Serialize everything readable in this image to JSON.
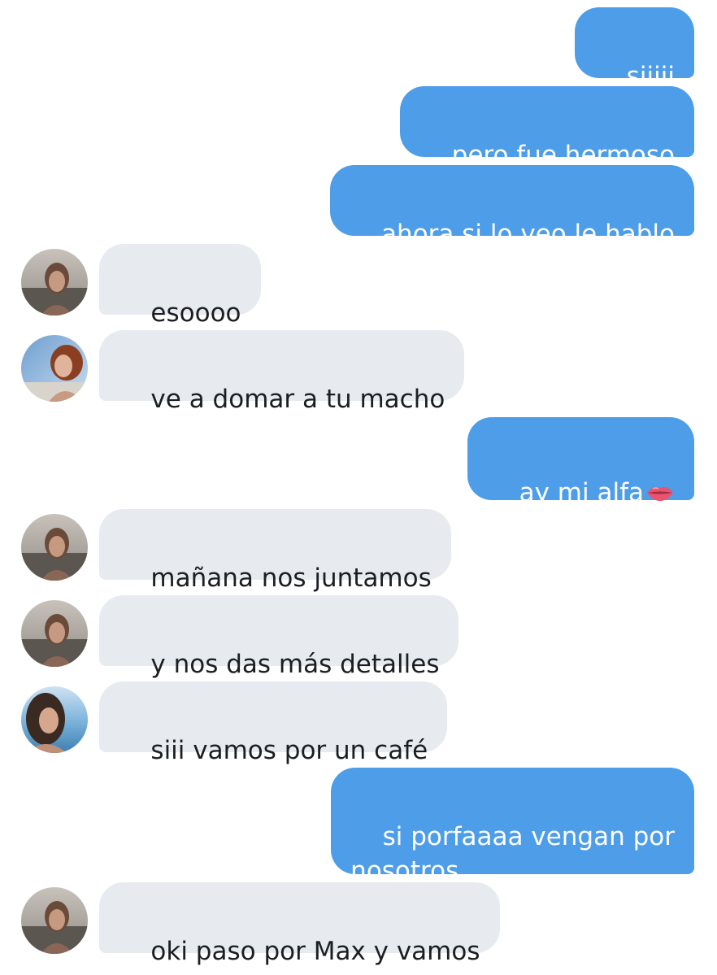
{
  "messages": [
    {
      "text": "siiiii"
    },
    {
      "text": "pero fue hermoso"
    },
    {
      "text": "ahora si lo veo le hablo"
    },
    {
      "text": "esoooo"
    },
    {
      "text": "ve a domar a tu macho"
    },
    {
      "text": "ay mi alfa",
      "emoji": "lips-emoji"
    },
    {
      "text": "mañana nos juntamos"
    },
    {
      "text": "y nos das más detalles"
    },
    {
      "text": "siii vamos por un café"
    },
    {
      "text": "si porfaaaa vengan por\nnosotros"
    },
    {
      "text": "oki paso por Max y vamos"
    }
  ],
  "colors": {
    "outgoing_bubble": "#4d9de9",
    "incoming_bubble": "#e7ebef",
    "outgoing_text": "#ffffff",
    "incoming_text": "#1b1f23"
  },
  "avatars": {
    "a": "avatar-beach-sunset-woman",
    "b": "avatar-red-hair-woman",
    "c": "avatar-dark-hair-woman-ocean"
  }
}
